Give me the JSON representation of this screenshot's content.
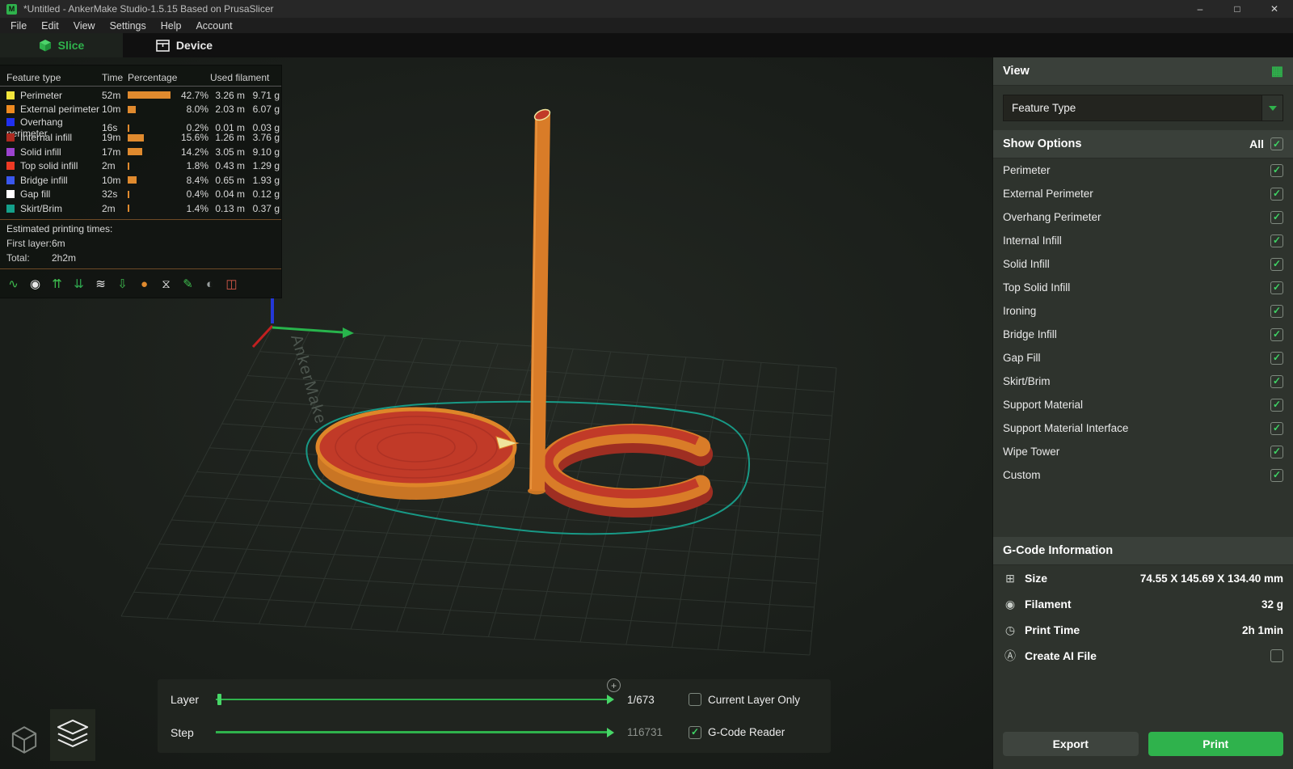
{
  "colors": {
    "accent": "#2fb24c",
    "skirt": "#18a08c",
    "orange": "#d97c28",
    "red": "#c13a28"
  },
  "window": {
    "logo_letter": "M",
    "title": "*Untitled - AnkerMake Studio-1.5.15 Based on PrusaSlicer",
    "controls": {
      "minimize": "–",
      "maximize": "□",
      "close": "✕"
    }
  },
  "menu": {
    "items": [
      "File",
      "Edit",
      "View",
      "Settings",
      "Help",
      "Account"
    ]
  },
  "tabs": [
    {
      "label": "Slice"
    },
    {
      "label": "Device"
    }
  ],
  "feature_panel": {
    "headers": {
      "feature": "Feature type",
      "time": "Time",
      "percentage": "Percentage",
      "used_filament": "Used filament"
    },
    "rows": [
      {
        "color": "#f2e63c",
        "label": "Perimeter",
        "time": "52m",
        "pct": 42.7,
        "pct_text": "42.7%",
        "length": "3.26 m",
        "weight": "9.71 g"
      },
      {
        "color": "#ee8a20",
        "label": "External perimeter",
        "time": "10m",
        "pct": 8.0,
        "pct_text": "8.0%",
        "length": "2.03 m",
        "weight": "6.07 g"
      },
      {
        "color": "#2030f0",
        "label": "Overhang perimeter",
        "time": "16s",
        "pct": 0.2,
        "pct_text": "0.2%",
        "length": "0.01 m",
        "weight": "0.03 g"
      },
      {
        "color": "#ad2a20",
        "label": "Internal infill",
        "time": "19m",
        "pct": 15.6,
        "pct_text": "15.6%",
        "length": "1.26 m",
        "weight": "3.76 g"
      },
      {
        "color": "#9c43cf",
        "label": "Solid infill",
        "time": "17m",
        "pct": 14.2,
        "pct_text": "14.2%",
        "length": "3.05 m",
        "weight": "9.10 g"
      },
      {
        "color": "#ee3a24",
        "label": "Top solid infill",
        "time": "2m",
        "pct": 1.8,
        "pct_text": "1.8%",
        "length": "0.43 m",
        "weight": "1.29 g"
      },
      {
        "color": "#3a57ee",
        "label": "Bridge infill",
        "time": "10m",
        "pct": 8.4,
        "pct_text": "8.4%",
        "length": "0.65 m",
        "weight": "1.93 g"
      },
      {
        "color": "#ffffff",
        "label": "Gap fill",
        "time": "32s",
        "pct": 0.4,
        "pct_text": "0.4%",
        "length": "0.04 m",
        "weight": "0.12 g"
      },
      {
        "color": "#14a08a",
        "label": "Skirt/Brim",
        "time": "2m",
        "pct": 1.4,
        "pct_text": "1.4%",
        "length": "0.13 m",
        "weight": "0.37 g"
      }
    ],
    "estimated": {
      "title": "Estimated printing times:",
      "first_layer_label": "First layer:",
      "first_layer_value": "6m",
      "total_label": "Total:",
      "total_value": "2h2m"
    },
    "legend_icons": [
      {
        "name": "travel-icon",
        "glyph": "∿",
        "color": "#3fbf4f"
      },
      {
        "name": "headform-icon",
        "glyph": "◉",
        "color": "#e8e8e8"
      },
      {
        "name": "retractions-icon",
        "glyph": "⇈",
        "color": "#3fbf4f"
      },
      {
        "name": "deretractions-icon",
        "glyph": "⇊",
        "color": "#2fa84f"
      },
      {
        "name": "seams-icon",
        "glyph": "≋",
        "color": "#e8e8e8"
      },
      {
        "name": "unload-icon",
        "glyph": "⇩",
        "color": "#3fbf4f"
      },
      {
        "name": "color-changes-icon",
        "glyph": "●",
        "color": "#e08a2e"
      },
      {
        "name": "estimated-time-icon",
        "glyph": "⧖",
        "color": "#e8e8e8"
      },
      {
        "name": "custom-gcode-icon",
        "glyph": "✎",
        "color": "#3fbf4f"
      },
      {
        "name": "shells-icon",
        "glyph": "◐",
        "color": "#9aa0a0"
      },
      {
        "name": "legend-icon",
        "glyph": "◫",
        "color": "#d85a4a"
      }
    ]
  },
  "scene": {
    "plate_brand": "AnkerMake"
  },
  "sliders": {
    "layer_label": "Layer",
    "layer_value": "1/673",
    "current_layer_only_label": "Current Layer Only",
    "current_layer_only_checked": false,
    "step_label": "Step",
    "step_value": "116731",
    "gcode_reader_label": "G-Code Reader",
    "gcode_reader_checked": true,
    "plus_glyph": "+"
  },
  "view_panel": {
    "title": "View",
    "grid_icon_glyph": "▦",
    "dropdown_value": "Feature Type",
    "show_options": {
      "title": "Show Options",
      "all_label": "All",
      "all_checked": true,
      "options": [
        {
          "label": "Perimeter",
          "checked": true
        },
        {
          "label": "External Perimeter",
          "checked": true
        },
        {
          "label": "Overhang Perimeter",
          "checked": true
        },
        {
          "label": "Internal Infill",
          "checked": true
        },
        {
          "label": "Solid Infill",
          "checked": true
        },
        {
          "label": "Top Solid Infill",
          "checked": true
        },
        {
          "label": "Ironing",
          "checked": true
        },
        {
          "label": "Bridge Infill",
          "checked": true
        },
        {
          "label": "Gap Fill",
          "checked": true
        },
        {
          "label": "Skirt/Brim",
          "checked": true
        },
        {
          "label": "Support Material",
          "checked": true
        },
        {
          "label": "Support Material Interface",
          "checked": true
        },
        {
          "label": "Wipe Tower",
          "checked": true
        },
        {
          "label": "Custom",
          "checked": true
        }
      ]
    }
  },
  "gcode_panel": {
    "title": "G-Code Information",
    "rows": [
      {
        "name": "size",
        "glyph": "⊞",
        "label": "Size",
        "value": "74.55 X 145.69 X 134.40 mm",
        "checkbox": false
      },
      {
        "name": "filament",
        "glyph": "◉",
        "label": "Filament",
        "value": "32 g",
        "checkbox": false
      },
      {
        "name": "print-time",
        "glyph": "◷",
        "label": "Print Time",
        "value": "2h 1min",
        "checkbox": false
      },
      {
        "name": "create-ai-file",
        "glyph": "Ⓐ",
        "label": "Create AI File",
        "value": "",
        "checkbox": true,
        "checked": false
      }
    ]
  },
  "actions": {
    "export_label": "Export",
    "print_label": "Print"
  }
}
